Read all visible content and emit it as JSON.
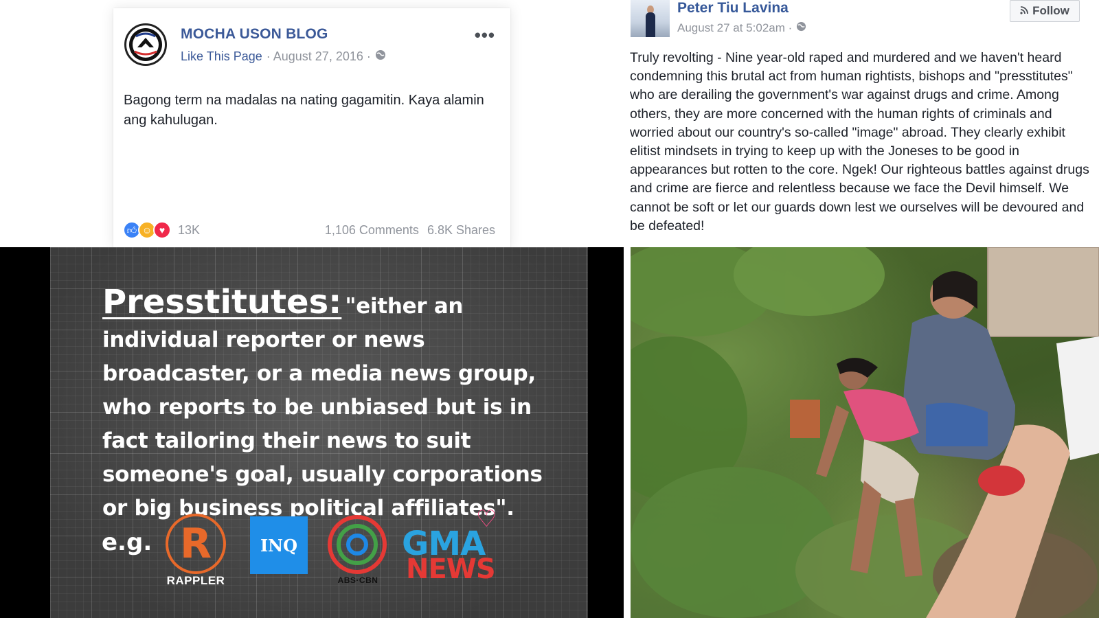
{
  "mocha_post": {
    "page_name": "MOCHA USON BLOG",
    "like_link": "Like This Page",
    "date": "· August 27, 2016 ·",
    "more_icon": "more-options-icon",
    "text": "Bagong term na madalas na nating gagamitin. Kaya alamin ang kahulugan.",
    "reactions": [
      "like-icon",
      "haha-icon",
      "love-icon"
    ],
    "reaction_count": "13K",
    "comments": "1,106 Comments",
    "shares": "6.8K Shares"
  },
  "peter_post": {
    "author": "Peter Tiu Lavina",
    "timestamp": "August 27 at 5:02am ·",
    "follow_label": "Follow",
    "text": "Truly revolting - Nine year-old raped and murdered and we haven't heard condemning this brutal act from human rightists, bishops and \"presstitutes\" who are derailing the government's war against drugs and crime. Among others, they are more concerned with the human rights of criminals and worried about our country's so-called \"image\" abroad. They clearly exhibit elitist mindsets in trying to keep up with the Joneses to be good in appearances but rotten to the core. Ngek! Our righteous battles against drugs and crime are fierce and relentless because we face the Devil himself. We cannot be soft or let our guards down lest we ourselves will be devoured and be defeated!"
  },
  "definition_graphic": {
    "term": "Presstitutes:",
    "definition": "\"either an individual reporter or news broadcaster, or a media news group, who reports to be unbiased but is in fact tailoring their news to suit someone's goal, usually corporations or big business political affiliates\".",
    "eg_label": "e.g.",
    "logos": {
      "rappler_mark": "R",
      "rappler_label": "RAPPLER",
      "inq_label": "INQ",
      "abs_label": "ABS·CBN",
      "gma_label": "GMA",
      "gma_news_label": "NEWS"
    }
  },
  "colors": {
    "facebook_blue": "#3b5998",
    "meta_gray": "#90949c",
    "rappler_orange": "#e8692a",
    "inq_blue": "#1f8ee8",
    "gma_blue": "#2aa3e0",
    "news_red": "#e53935"
  }
}
